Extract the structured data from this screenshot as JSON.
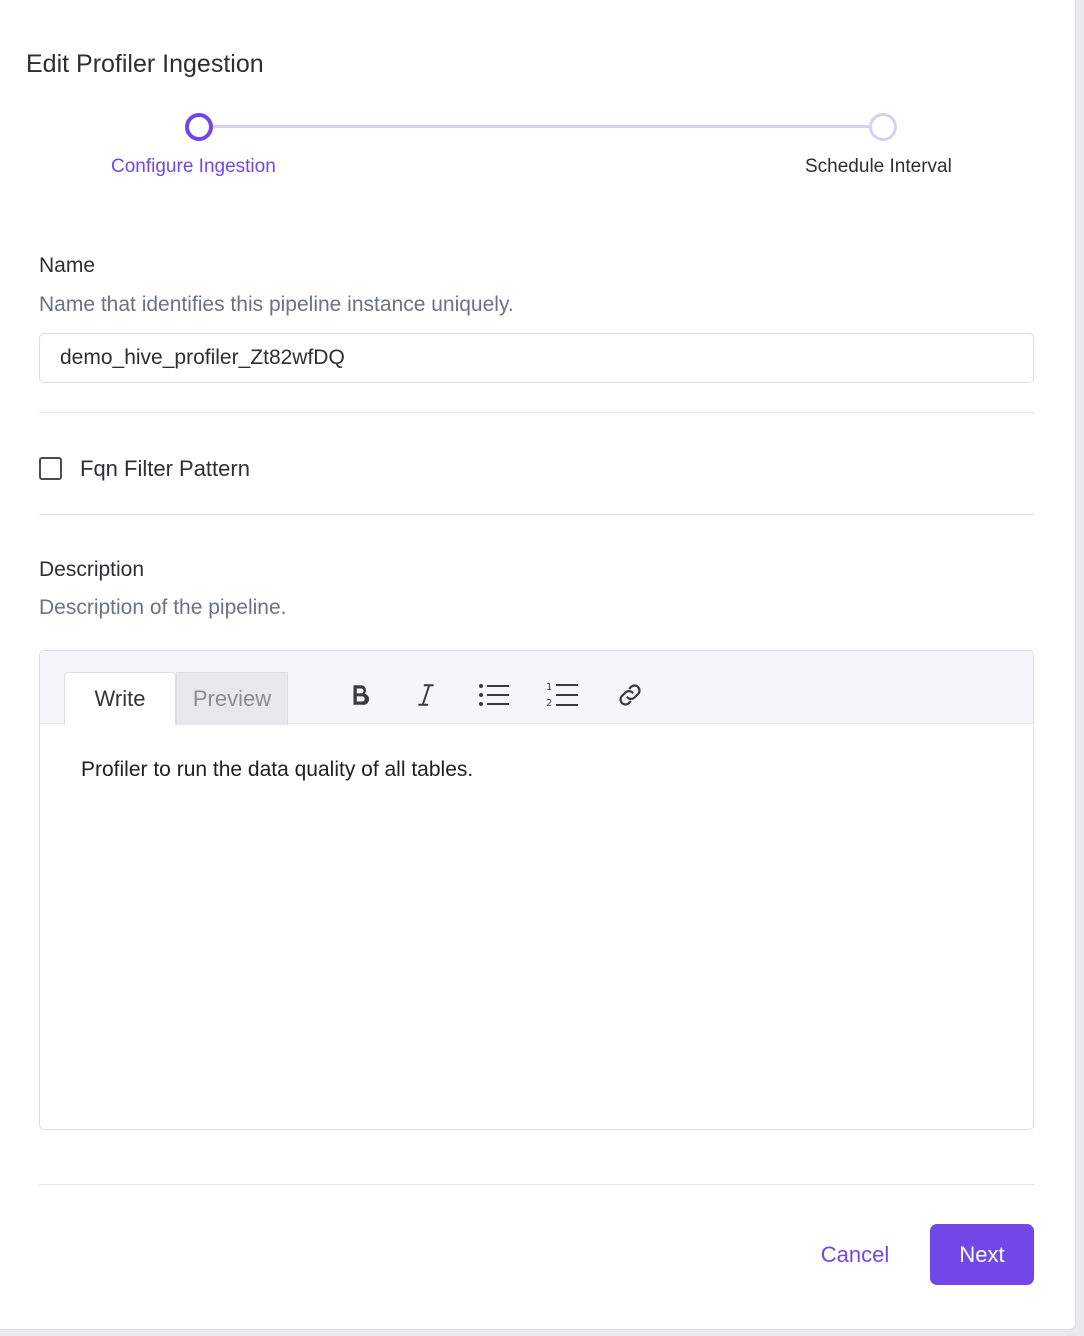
{
  "dialog": {
    "title": "Edit Profiler Ingestion"
  },
  "stepper": {
    "steps": [
      {
        "label": "Configure Ingestion",
        "state": "active"
      },
      {
        "label": "Schedule Interval",
        "state": "pending"
      }
    ],
    "accent_color": "#7147e8"
  },
  "name_field": {
    "label": "Name",
    "help": "Name that identifies this pipeline instance uniquely.",
    "value": "demo_hive_profiler_Zt82wfDQ"
  },
  "fqn_filter": {
    "label": "Fqn Filter Pattern",
    "checked": false
  },
  "description_field": {
    "label": "Description",
    "help": "Description of the pipeline.",
    "tabs": [
      {
        "label": "Write",
        "active": true
      },
      {
        "label": "Preview",
        "active": false
      }
    ],
    "toolbar_icons": [
      "bold-icon",
      "italic-icon",
      "bulleted-list-icon",
      "numbered-list-icon",
      "link-icon"
    ],
    "content": "Profiler to run the data quality of all tables."
  },
  "actions": {
    "cancel_label": "Cancel",
    "next_label": "Next"
  }
}
